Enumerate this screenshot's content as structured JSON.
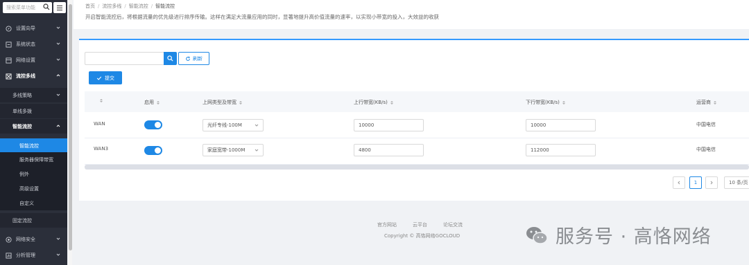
{
  "sidebar": {
    "search_placeholder": "搜索菜单功能",
    "items": [
      {
        "label": "设置向导",
        "icon": "compass-icon"
      },
      {
        "label": "系统状态",
        "icon": "monitor-icon"
      },
      {
        "label": "网络设置",
        "icon": "network-icon"
      },
      {
        "label": "流控多线",
        "icon": "flow-icon"
      },
      {
        "label": "网络安全",
        "icon": "shield-icon"
      },
      {
        "label": "分析管理",
        "icon": "chart-icon"
      }
    ],
    "sub_items": [
      "多线策略",
      "单线多拨",
      "智能流控",
      "固定流控"
    ],
    "sub_sub_items": [
      "智能流控",
      "服务器保障带宽",
      "例外",
      "高级设置",
      "自定义"
    ]
  },
  "header": {
    "breadcrumb": [
      "首页",
      "流控多线",
      "智能流控",
      "智能流控"
    ],
    "description": "开启智能流控后，将根据流量的优先级进行排序传输。这样在满足大流量应用的同时，显著地提升高价值流量的速率，以实现小带宽的投入，大效益的收获"
  },
  "toolbar": {
    "search_value": "",
    "refresh_label": "刷新",
    "submit_label": "提交"
  },
  "table": {
    "columns": [
      "",
      "启用",
      "上网类型及带宽",
      "上行带宽(KB/s)",
      "下行带宽(KB/s)",
      "运营商"
    ],
    "rows": [
      {
        "name": "WAN",
        "enabled": true,
        "type": "光纤专线-100M",
        "up": "10000",
        "down": "10000",
        "isp": "中国电信"
      },
      {
        "name": "WAN3",
        "enabled": true,
        "type": "家庭宽带-1000M",
        "up": "4800",
        "down": "112000",
        "isp": "中国电信"
      }
    ]
  },
  "pagination": {
    "current": "1",
    "size_label": "10 条/页"
  },
  "footer": {
    "links": [
      "官方网站",
      "云平台",
      "论坛交流"
    ],
    "copyright": "Copyright © 高恪网络GOCLOUD"
  },
  "watermark": {
    "text": "服务号 · 高恪网络"
  },
  "colors": {
    "accent": "#1e88e5",
    "sidebar_bg": "#2b2f3a"
  }
}
